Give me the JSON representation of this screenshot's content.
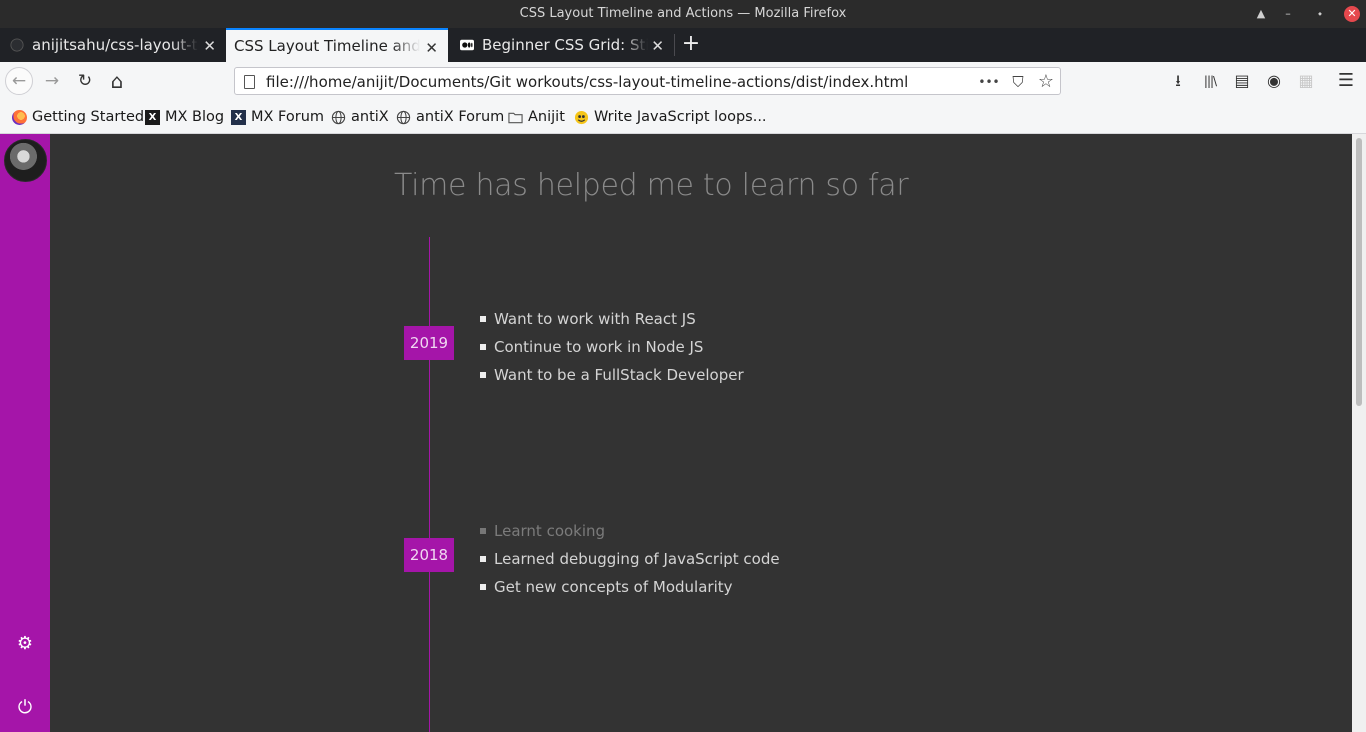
{
  "window": {
    "title": "CSS Layout Timeline and Actions — Mozilla Firefox",
    "controls": [
      "▲",
      "–",
      "⬩",
      "✕"
    ]
  },
  "tabs": [
    {
      "label": "anijitsahu/css-layout-timeline-actions",
      "active": false,
      "icon": "github-icon"
    },
    {
      "label": "CSS Layout Timeline and Actions",
      "active": true,
      "icon": "none"
    },
    {
      "label": "Beginner CSS Grid: Sticky Footer",
      "active": false,
      "icon": "medium-icon"
    }
  ],
  "newtab_label": "+",
  "close_glyph": "✕",
  "nav": {
    "url": "file:///home/anijit/Documents/Git workouts/css-layout-timeline-actions/dist/index.html",
    "back": "←",
    "forward": "→",
    "reload": "↻",
    "home": "⌂",
    "page_actions": "•••",
    "pocket": "⛉",
    "star": "☆",
    "downloads": "⭳",
    "library": "|||\\",
    "sidebar": "▤",
    "account": "◉",
    "extension": "▦",
    "menu": "☰"
  },
  "bookmarks": [
    {
      "label": "Getting Started",
      "icon": "firefox-icon"
    },
    {
      "label": "MX Blog",
      "icon": "mx-icon"
    },
    {
      "label": "MX Forum",
      "icon": "mx-icon"
    },
    {
      "label": "antiX",
      "icon": "globe-icon"
    },
    {
      "label": "antiX Forum",
      "icon": "globe-icon"
    },
    {
      "label": "Anijit",
      "icon": "folder-icon"
    },
    {
      "label": "Write JavaScript loops...",
      "icon": "freecodecamp-icon"
    }
  ],
  "page": {
    "title": "Time has helped me to learn so far",
    "sidebar_icons": {
      "settings": "⚙",
      "power": "⏻"
    },
    "timeline": [
      {
        "year": "2019",
        "items": [
          {
            "text": "Want to work with React JS",
            "dim": false
          },
          {
            "text": "Continue to work in Node JS",
            "dim": false
          },
          {
            "text": "Want to be a FullStack Developer",
            "dim": false
          }
        ]
      },
      {
        "year": "2018",
        "items": [
          {
            "text": "Learnt cooking",
            "dim": true
          },
          {
            "text": "Learned debugging of JavaScript code",
            "dim": false
          },
          {
            "text": "Get new concepts of Modularity",
            "dim": false
          }
        ]
      }
    ]
  },
  "colors": {
    "accent": "#a515a9",
    "page_bg": "#333333",
    "tab_accent": "#0a84ff"
  }
}
